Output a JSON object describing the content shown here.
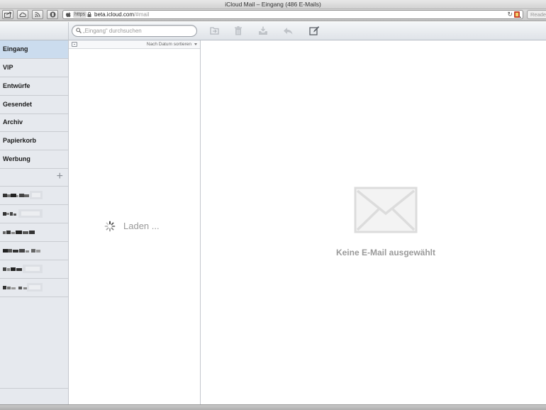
{
  "window": {
    "title": "iCloud Mail – Eingang (486 E-Mails)"
  },
  "browser": {
    "url_scheme": "https",
    "url_host": "beta.icloud.com",
    "url_path": "/#mail",
    "reader_label": "Reader"
  },
  "search": {
    "placeholder": "„Eingang“ durchsuchen"
  },
  "toolbar": {
    "icons": [
      "move-to-folder-icon",
      "trash-icon",
      "archive-icon",
      "reply-icon",
      "compose-icon"
    ]
  },
  "sidebar": {
    "folders": [
      {
        "label": "Eingang",
        "selected": true
      },
      {
        "label": "VIP"
      },
      {
        "label": "Entwürfe"
      },
      {
        "label": "Gesendet"
      },
      {
        "label": "Archiv"
      },
      {
        "label": "Papierkorb"
      },
      {
        "label": "Werbung"
      }
    ],
    "add_symbol": "+"
  },
  "message_list": {
    "sort_label": "Nach Datum sortieren",
    "loading_text": "Laden ..."
  },
  "reading_pane": {
    "empty_text": "Keine E-Mail ausgewählt"
  },
  "colors": {
    "selected_folder_bg": "#cbdcee",
    "sidebar_bg": "#e6e9ee",
    "muted_text": "#9a9a9a"
  }
}
